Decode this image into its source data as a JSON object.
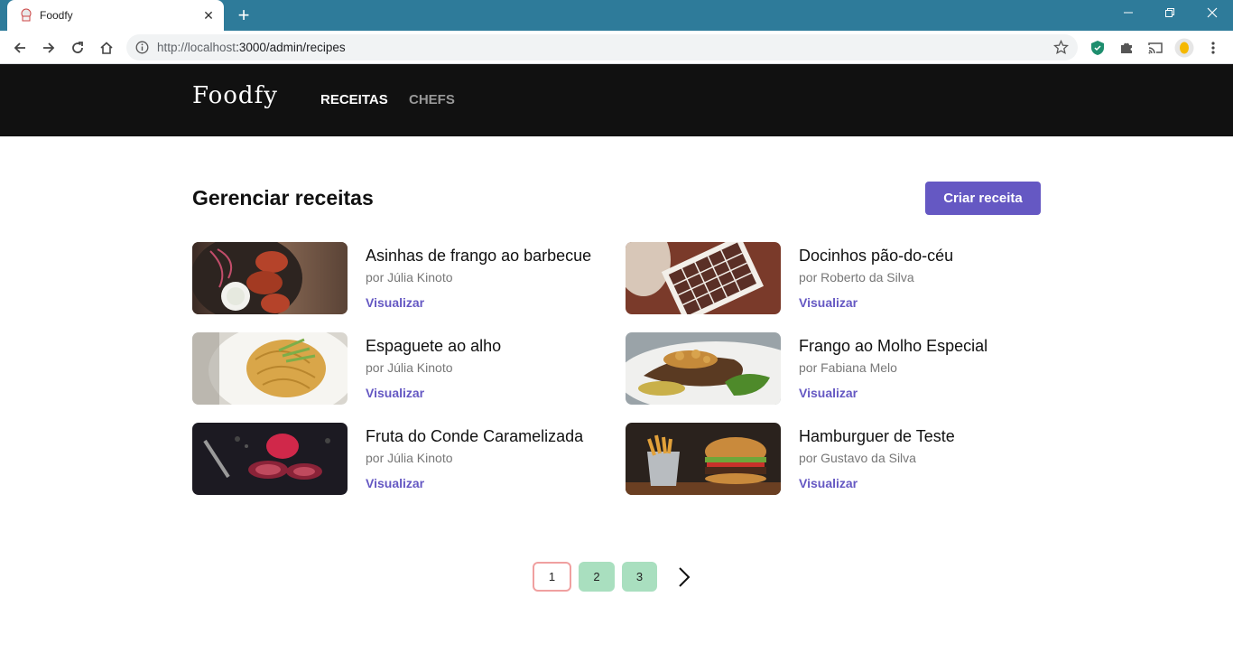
{
  "browser": {
    "tab_title": "Foodfy",
    "url_host": "http://localhost",
    "url_rest": ":3000/admin/recipes",
    "new_tab": "+",
    "tab_close": "✕"
  },
  "header": {
    "logo": "Foodfy",
    "nav": [
      {
        "label": "RECEITAS",
        "active": true
      },
      {
        "label": "CHEFS",
        "active": false
      }
    ]
  },
  "main": {
    "title": "Gerenciar receitas",
    "create_button": "Criar receita",
    "view_label": "Visualizar",
    "recipes": [
      {
        "title": "Asinhas de frango ao barbecue",
        "author": "por Júlia Kinoto",
        "image": "chicken-wings"
      },
      {
        "title": "Docinhos pão-do-céu",
        "author": "por Roberto da Silva",
        "image": "chocolates"
      },
      {
        "title": "Espaguete ao alho",
        "author": "por Júlia Kinoto",
        "image": "spaghetti"
      },
      {
        "title": "Frango ao Molho Especial",
        "author": "por Fabiana Melo",
        "image": "chicken-plate"
      },
      {
        "title": "Fruta do Conde Caramelizada",
        "author": "por Júlia Kinoto",
        "image": "fruit"
      },
      {
        "title": "Hamburguer de Teste",
        "author": "por Gustavo da Silva",
        "image": "burger"
      }
    ]
  },
  "pagination": {
    "pages": [
      "1",
      "2",
      "3"
    ],
    "current": "1"
  },
  "colors": {
    "accent": "#6558c3",
    "header_bg": "#111111",
    "chrome_bg": "#2e7b9a",
    "page_current_border": "#f0a0a0",
    "page_other_bg": "#a9dfbf"
  }
}
